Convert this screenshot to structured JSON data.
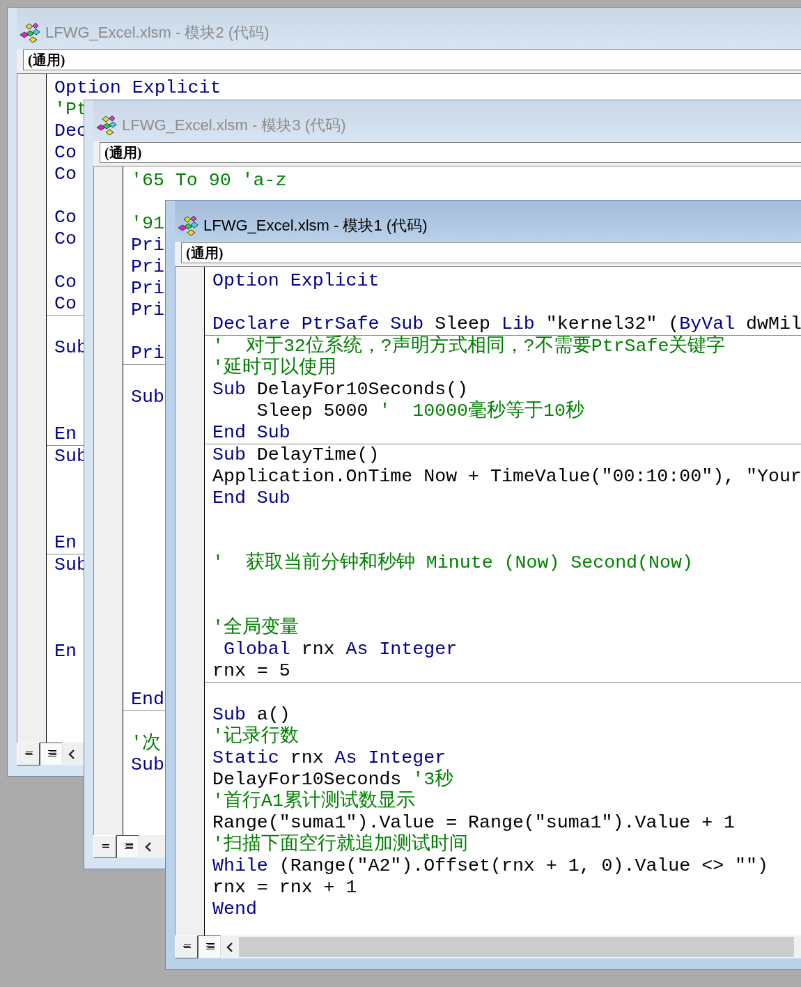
{
  "windows": [
    {
      "title": "LFWG_Excel.xlsm - 模块2 (代码)",
      "active": false,
      "procedure": "(通用)",
      "view_buttons": [
        {
          "selected": false
        },
        {
          "selected": true
        }
      ],
      "blocks": [
        [
          {
            "kind": "code",
            "segments": [
              {
                "kind": "keyword",
                "text": "Option Explicit"
              }
            ]
          },
          {
            "kind": "code",
            "segments": [
              {
                "kind": "comment",
                "text": "'Pt"
              }
            ]
          },
          {
            "kind": "code",
            "segments": [
              {
                "kind": "keyword",
                "text": "Dec"
              }
            ]
          },
          {
            "kind": "code",
            "segments": [
              {
                "kind": "keyword",
                "text": "Co"
              }
            ]
          },
          {
            "kind": "code",
            "segments": [
              {
                "kind": "keyword",
                "text": "Co"
              }
            ]
          },
          {
            "kind": "blank"
          },
          {
            "kind": "code",
            "segments": [
              {
                "kind": "keyword",
                "text": "Co"
              }
            ]
          },
          {
            "kind": "code",
            "segments": [
              {
                "kind": "keyword",
                "text": "Co"
              }
            ]
          },
          {
            "kind": "blank"
          },
          {
            "kind": "code",
            "segments": [
              {
                "kind": "keyword",
                "text": "Co"
              }
            ]
          },
          {
            "kind": "code",
            "segments": [
              {
                "kind": "keyword",
                "text": "Co"
              }
            ]
          }
        ],
        [
          {
            "kind": "blank"
          },
          {
            "kind": "code",
            "segments": [
              {
                "kind": "keyword",
                "text": "Sub"
              }
            ]
          },
          {
            "kind": "blank"
          },
          {
            "kind": "blank"
          },
          {
            "kind": "blank"
          },
          {
            "kind": "code",
            "segments": [
              {
                "kind": "keyword",
                "text": "En"
              }
            ]
          }
        ],
        [
          {
            "kind": "code",
            "segments": [
              {
                "kind": "keyword",
                "text": "Sub"
              }
            ]
          },
          {
            "kind": "blank"
          },
          {
            "kind": "blank"
          },
          {
            "kind": "blank"
          },
          {
            "kind": "code",
            "segments": [
              {
                "kind": "keyword",
                "text": "En"
              }
            ]
          }
        ],
        [
          {
            "kind": "code",
            "segments": [
              {
                "kind": "keyword",
                "text": "Sub"
              }
            ]
          },
          {
            "kind": "blank"
          },
          {
            "kind": "blank"
          },
          {
            "kind": "blank"
          },
          {
            "kind": "code",
            "segments": [
              {
                "kind": "keyword",
                "text": "En"
              }
            ]
          }
        ]
      ]
    },
    {
      "title": "LFWG_Excel.xlsm - 模块3 (代码)",
      "active": false,
      "procedure": "(通用)",
      "view_buttons": [
        {
          "selected": false
        },
        {
          "selected": true
        }
      ],
      "blocks": [
        [
          {
            "kind": "code",
            "segments": [
              {
                "kind": "comment",
                "text": "'65 To 90 'a-z"
              }
            ]
          },
          {
            "kind": "blank"
          },
          {
            "kind": "code",
            "segments": [
              {
                "kind": "comment",
                "text": "'91"
              }
            ]
          },
          {
            "kind": "code",
            "segments": [
              {
                "kind": "keyword",
                "text": "Pri"
              }
            ]
          },
          {
            "kind": "code",
            "segments": [
              {
                "kind": "keyword",
                "text": "Pri"
              }
            ]
          },
          {
            "kind": "code",
            "segments": [
              {
                "kind": "keyword",
                "text": "Pri"
              }
            ]
          },
          {
            "kind": "code",
            "segments": [
              {
                "kind": "keyword",
                "text": "Pri"
              }
            ]
          },
          {
            "kind": "blank"
          },
          {
            "kind": "code",
            "segments": [
              {
                "kind": "keyword",
                "text": "Pri"
              }
            ]
          }
        ],
        [
          {
            "kind": "blank"
          },
          {
            "kind": "code",
            "segments": [
              {
                "kind": "keyword",
                "text": "Sub"
              }
            ]
          },
          {
            "kind": "blank"
          },
          {
            "kind": "blank"
          },
          {
            "kind": "blank"
          },
          {
            "kind": "blank"
          },
          {
            "kind": "blank"
          },
          {
            "kind": "blank"
          },
          {
            "kind": "blank"
          },
          {
            "kind": "blank"
          },
          {
            "kind": "blank"
          },
          {
            "kind": "blank"
          },
          {
            "kind": "blank"
          },
          {
            "kind": "blank"
          },
          {
            "kind": "blank"
          },
          {
            "kind": "code",
            "segments": [
              {
                "kind": "keyword",
                "text": "End"
              }
            ]
          }
        ],
        [
          {
            "kind": "blank"
          },
          {
            "kind": "code",
            "segments": [
              {
                "kind": "comment",
                "text": "'次"
              }
            ]
          },
          {
            "kind": "code",
            "segments": [
              {
                "kind": "keyword",
                "text": "Sub"
              }
            ]
          }
        ]
      ]
    },
    {
      "title": "LFWG_Excel.xlsm - 模块1 (代码)",
      "active": true,
      "procedure": "(通用)",
      "view_buttons": [
        {
          "selected": false
        },
        {
          "selected": true
        }
      ],
      "blocks": [
        [
          {
            "kind": "code",
            "segments": [
              {
                "kind": "keyword",
                "text": "Option Explicit"
              }
            ]
          },
          {
            "kind": "blank"
          },
          {
            "kind": "code",
            "segments": [
              {
                "kind": "keyword",
                "text": "Declare PtrSafe Sub "
              },
              {
                "kind": "plain",
                "text": "Sleep "
              },
              {
                "kind": "keyword",
                "text": "Lib "
              },
              {
                "kind": "plain",
                "text": "\"kernel32\" ("
              },
              {
                "kind": "keyword",
                "text": "ByVal "
              },
              {
                "kind": "plain",
                "text": "dwMil"
              }
            ]
          }
        ],
        [
          {
            "kind": "code",
            "segments": [
              {
                "kind": "comment",
                "text": "'  对于32位系统，?声明方式相同，?不需要PtrSafe关键字"
              }
            ]
          },
          {
            "kind": "code",
            "segments": [
              {
                "kind": "comment",
                "text": "'延时可以使用"
              }
            ]
          },
          {
            "kind": "code",
            "segments": [
              {
                "kind": "keyword",
                "text": "Sub "
              },
              {
                "kind": "plain",
                "text": "DelayFor10Seconds()"
              }
            ]
          },
          {
            "kind": "code",
            "segments": [
              {
                "kind": "plain",
                "text": "    Sleep 5000 "
              },
              {
                "kind": "comment",
                "text": "'  10000毫秒等于10秒"
              }
            ]
          },
          {
            "kind": "code",
            "segments": [
              {
                "kind": "keyword",
                "text": "End Sub"
              }
            ]
          }
        ],
        [
          {
            "kind": "code",
            "segments": [
              {
                "kind": "keyword",
                "text": "Sub "
              },
              {
                "kind": "plain",
                "text": "DelayTime()"
              }
            ]
          },
          {
            "kind": "code",
            "segments": [
              {
                "kind": "plain",
                "text": "Application.OnTime Now + TimeValue(\"00:10:00\"), \"Your"
              }
            ]
          },
          {
            "kind": "code",
            "segments": [
              {
                "kind": "keyword",
                "text": "End Sub"
              }
            ]
          },
          {
            "kind": "blank"
          },
          {
            "kind": "blank"
          },
          {
            "kind": "code",
            "segments": [
              {
                "kind": "comment",
                "text": "'  获取当前分钟和秒钟 Minute (Now) Second(Now)"
              }
            ]
          },
          {
            "kind": "blank"
          },
          {
            "kind": "blank"
          },
          {
            "kind": "code",
            "segments": [
              {
                "kind": "comment",
                "text": "'全局变量"
              }
            ]
          },
          {
            "kind": "code",
            "segments": [
              {
                "kind": "keyword",
                "text": " Global "
              },
              {
                "kind": "plain",
                "text": "rnx "
              },
              {
                "kind": "keyword",
                "text": "As Integer"
              }
            ]
          },
          {
            "kind": "code",
            "segments": [
              {
                "kind": "plain",
                "text": "rnx = 5"
              }
            ]
          }
        ],
        [
          {
            "kind": "blank"
          },
          {
            "kind": "code",
            "segments": [
              {
                "kind": "keyword",
                "text": "Sub "
              },
              {
                "kind": "plain",
                "text": "a()"
              }
            ]
          },
          {
            "kind": "code",
            "segments": [
              {
                "kind": "comment",
                "text": "'记录行数"
              }
            ]
          },
          {
            "kind": "code",
            "segments": [
              {
                "kind": "keyword",
                "text": "Static "
              },
              {
                "kind": "plain",
                "text": "rnx "
              },
              {
                "kind": "keyword",
                "text": "As Integer"
              }
            ]
          },
          {
            "kind": "code",
            "segments": [
              {
                "kind": "plain",
                "text": "DelayFor10Seconds "
              },
              {
                "kind": "comment",
                "text": "'3秒"
              }
            ]
          },
          {
            "kind": "code",
            "segments": [
              {
                "kind": "comment",
                "text": "'首行A1累计测试数显示"
              }
            ]
          },
          {
            "kind": "code",
            "segments": [
              {
                "kind": "plain",
                "text": "Range(\"suma1\").Value = Range(\"suma1\").Value + 1"
              }
            ]
          },
          {
            "kind": "code",
            "segments": [
              {
                "kind": "comment",
                "text": "'扫描下面空行就追加测试时间"
              }
            ]
          },
          {
            "kind": "code",
            "segments": [
              {
                "kind": "keyword",
                "text": "While "
              },
              {
                "kind": "plain",
                "text": "(Range(\"A2\").Offset(rnx + 1, 0).Value <> \"\")"
              }
            ]
          },
          {
            "kind": "code",
            "segments": [
              {
                "kind": "plain",
                "text": "rnx = rnx + 1"
              }
            ]
          },
          {
            "kind": "code",
            "segments": [
              {
                "kind": "keyword",
                "text": "Wend"
              }
            ]
          }
        ]
      ]
    }
  ]
}
